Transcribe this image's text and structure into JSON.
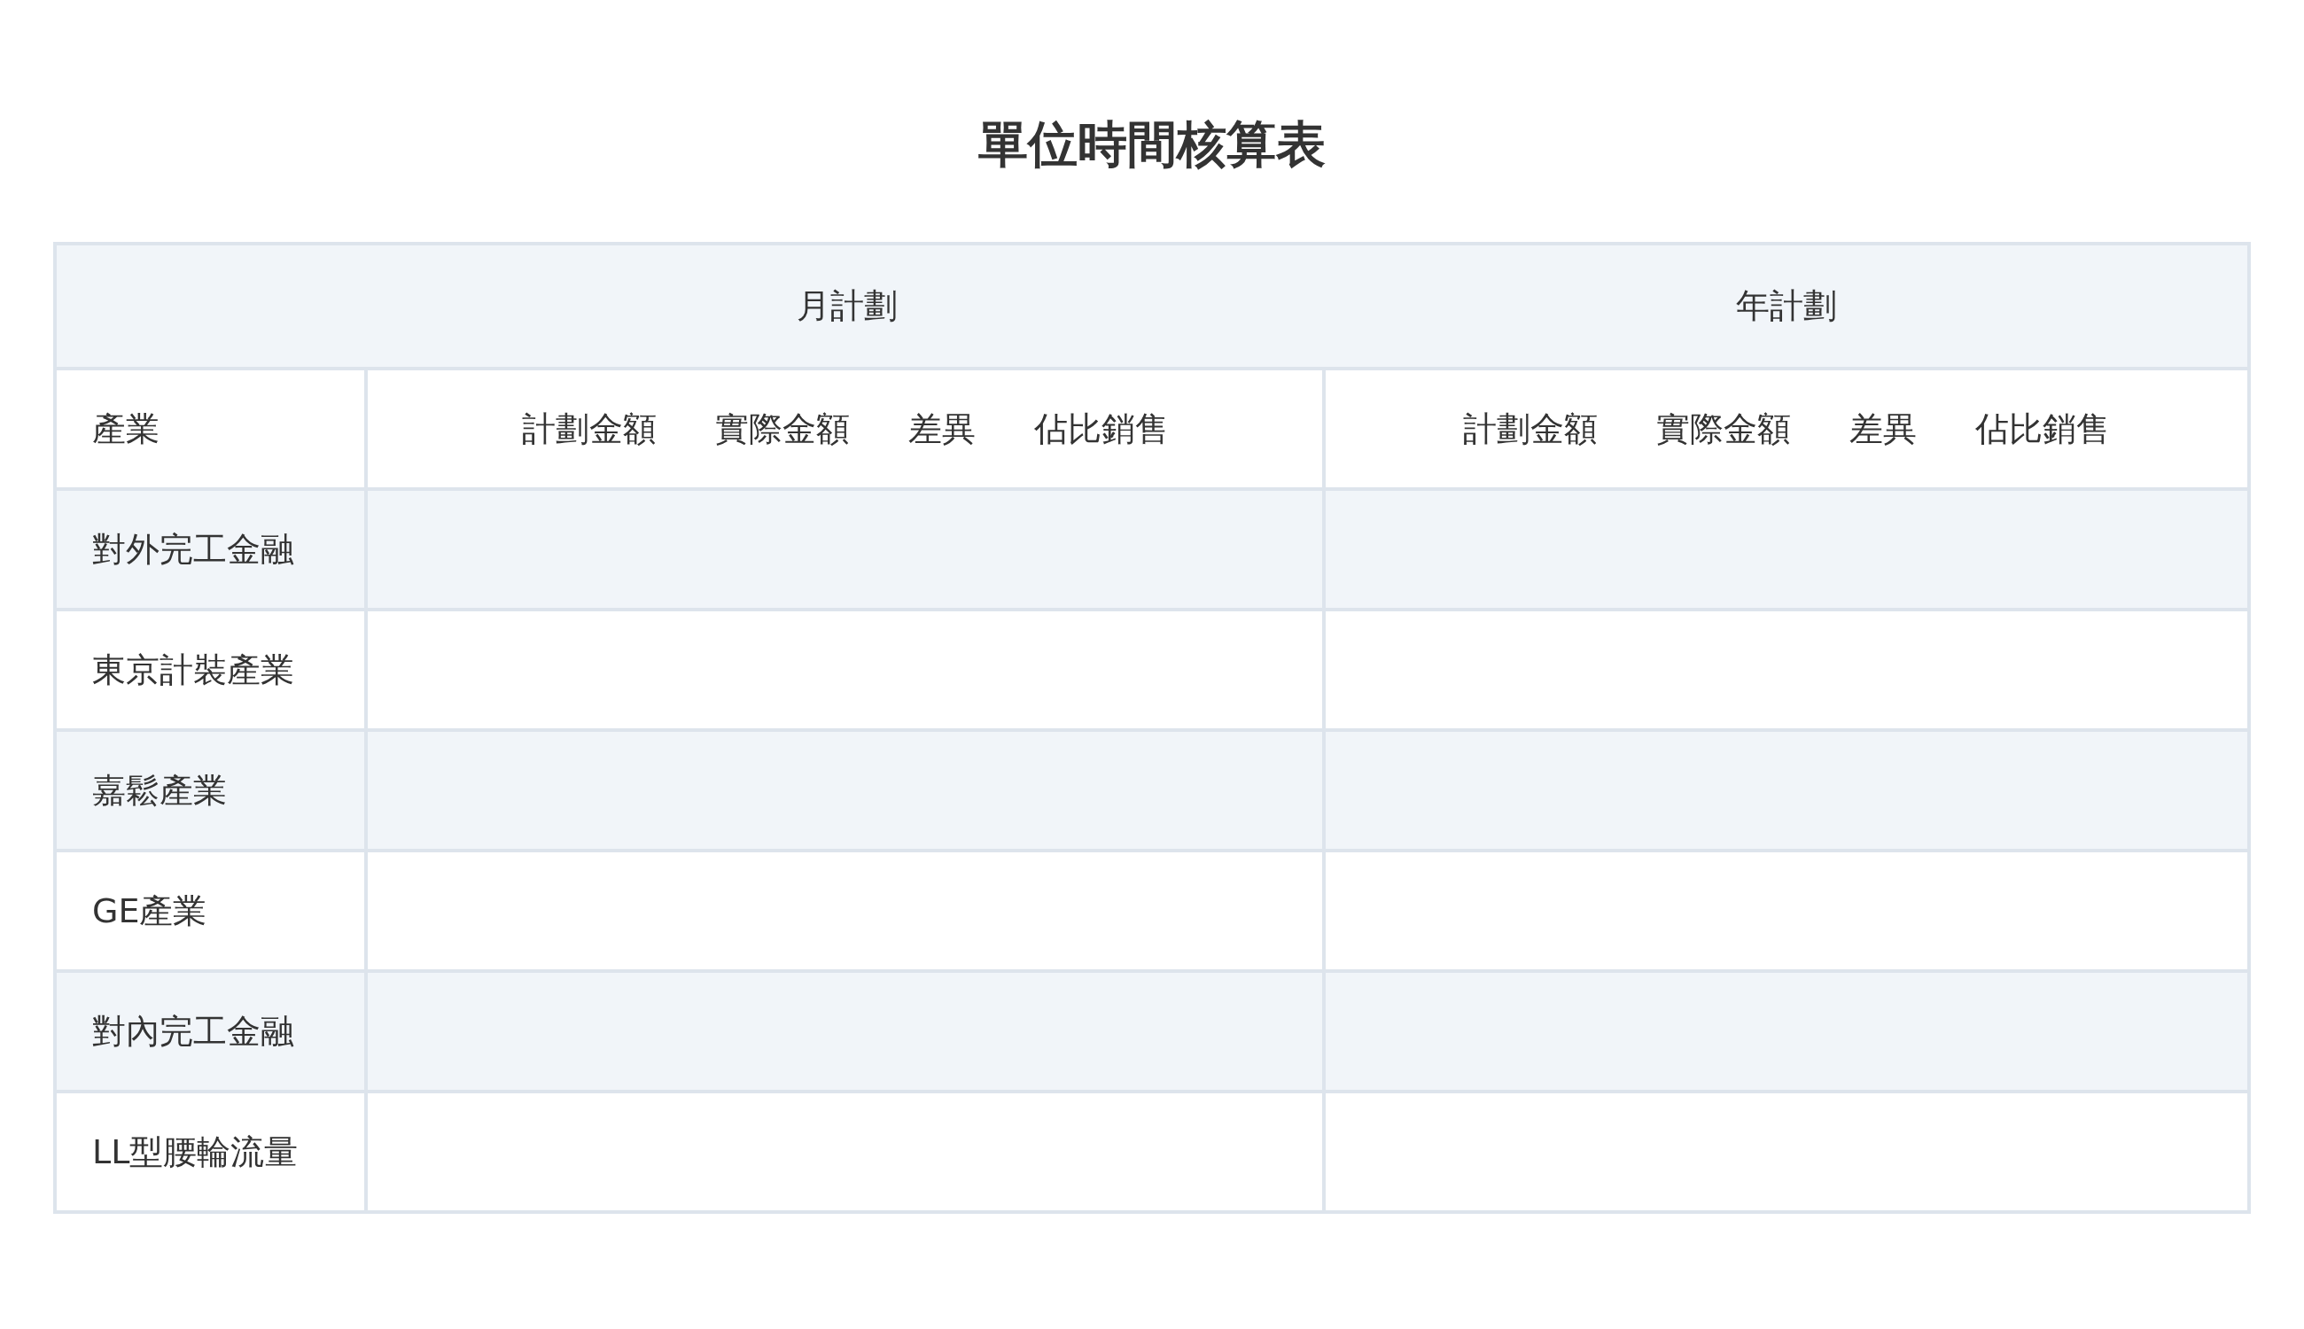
{
  "title": "單位時間核算表",
  "table": {
    "groups": [
      {
        "label": "月計劃",
        "columns": [
          "計劃金額",
          "實際金額",
          "差異",
          "佔比銷售"
        ]
      },
      {
        "label": "年計劃",
        "columns": [
          "計劃金額",
          "實際金額",
          "差異",
          "佔比銷售"
        ]
      }
    ],
    "row_header": "產業",
    "rows": [
      {
        "label": "對外完工金融"
      },
      {
        "label": "東京計裝產業"
      },
      {
        "label": "嘉鬆產業"
      },
      {
        "label": "GE產業"
      },
      {
        "label": "對內完工金融"
      },
      {
        "label": "LL型腰輪流量"
      }
    ]
  }
}
